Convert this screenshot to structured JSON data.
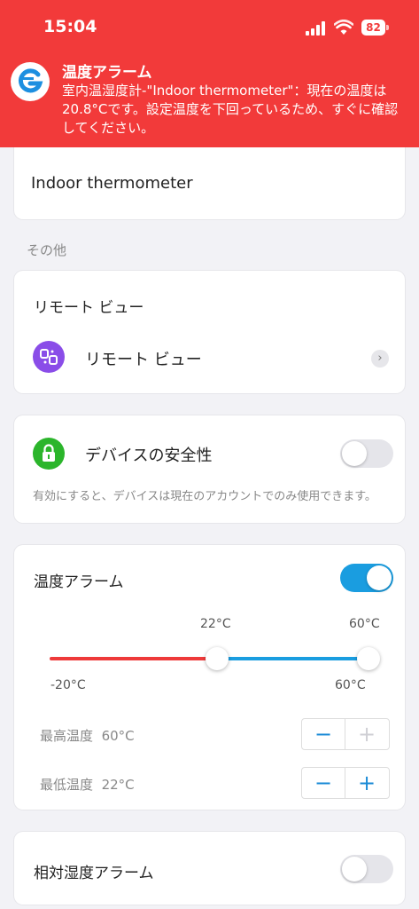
{
  "status_bar": {
    "time": "15:04",
    "battery": "82"
  },
  "notification": {
    "title": "温度アラーム",
    "body": "室内温湿度計-\"Indoor thermometer\"：現在の温度は20.8°Cです。設定温度を下回っているため、すぐに確認してください。"
  },
  "device_name": {
    "value": "Indoor thermometer"
  },
  "section_other": "その他",
  "remote_view": {
    "header": "リモート ビュー",
    "item_label": "リモート ビュー"
  },
  "security": {
    "label": "デバイスの安全性",
    "enabled": false,
    "description": "有効にすると、デバイスは現在のアカウントでのみ使用できます。"
  },
  "temperature_alarm": {
    "label": "温度アラーム",
    "enabled": true,
    "range_min_label": "-20°C",
    "range_max_label": "60°C",
    "low_value_label": "22°C",
    "high_value_label": "60°C",
    "range_min": -20,
    "range_max": 60,
    "low_value": 22,
    "high_value": 60,
    "max_temp": {
      "label": "最高温度",
      "value": "60°C"
    },
    "min_temp": {
      "label": "最低温度",
      "value": "22°C"
    },
    "minus": "−",
    "plus": "+"
  },
  "humidity_alarm": {
    "label": "相対湿度アラーム",
    "enabled": false
  },
  "colors": {
    "alarm_red": "#f23a3a",
    "accent_blue": "#1a9de0",
    "lock_green": "#2bb52b",
    "remote_purple": "#8a4de8"
  }
}
